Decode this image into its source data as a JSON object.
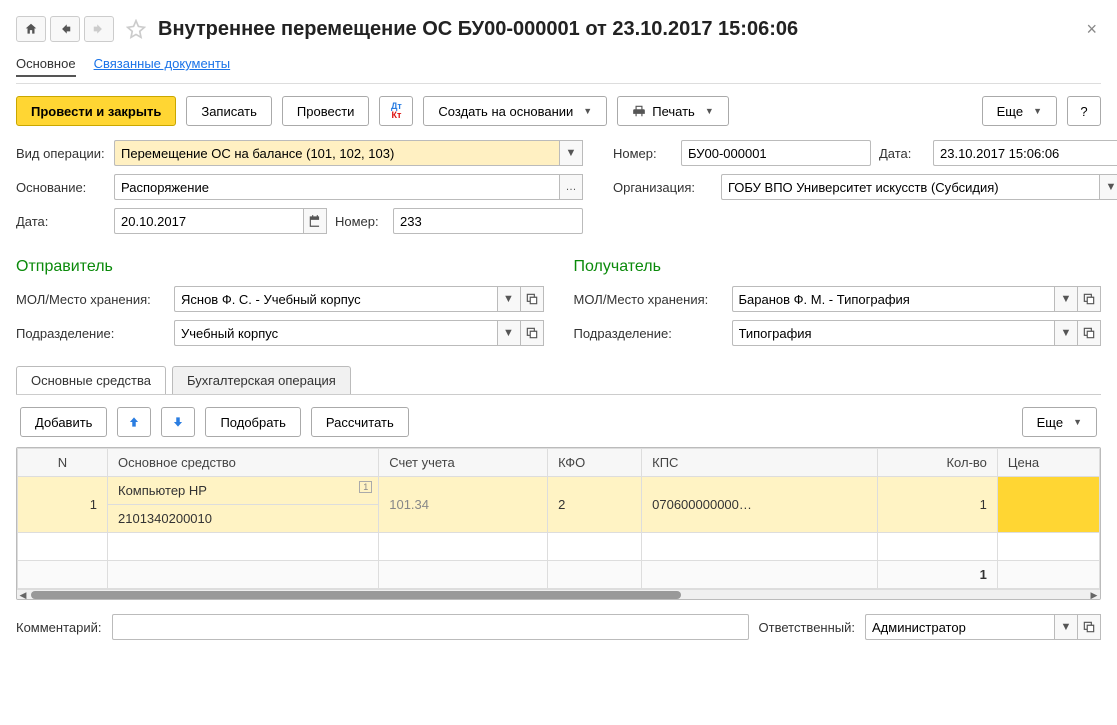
{
  "header": {
    "title": "Внутреннее перемещение ОС БУ00-000001 от 23.10.2017 15:06:06"
  },
  "nav_tabs": {
    "main": "Основное",
    "linked": "Связанные документы"
  },
  "toolbar": {
    "post_close": "Провести и закрыть",
    "save": "Записать",
    "post": "Провести",
    "create_based": "Создать на основании",
    "print": "Печать",
    "more": "Еще",
    "help": "?"
  },
  "fields": {
    "operation_type_label": "Вид операции:",
    "operation_type_value": "Перемещение ОС на балансе (101, 102, 103)",
    "number_label": "Номер:",
    "number_value": "БУ00-000001",
    "date_label": "Дата:",
    "date_value": "23.10.2017 15:06:06",
    "basis_label": "Основание:",
    "basis_value": "Распоряжение",
    "org_label": "Организация:",
    "org_value": "ГОБУ ВПО Университет искусств (Субсидия)",
    "basis_date_label": "Дата:",
    "basis_date_value": "20.10.2017",
    "basis_number_label": "Номер:",
    "basis_number_value": "233"
  },
  "sender": {
    "title": "Отправитель",
    "mol_label": "МОЛ/Место хранения:",
    "mol_value": "Яснов Ф. С. - Учебный корпус",
    "dept_label": "Подразделение:",
    "dept_value": "Учебный корпус"
  },
  "receiver": {
    "title": "Получатель",
    "mol_label": "МОЛ/Место хранения:",
    "mol_value": "Баранов Ф. М. - Типография",
    "dept_label": "Подразделение:",
    "dept_value": "Типография"
  },
  "subtabs": {
    "assets": "Основные средства",
    "accounting": "Бухгалтерская операция"
  },
  "table_toolbar": {
    "add": "Добавить",
    "select": "Подобрать",
    "calculate": "Рассчитать",
    "more": "Еще"
  },
  "table": {
    "headers": {
      "n": "N",
      "asset": "Основное средство",
      "account": "Счет учета",
      "kfo": "КФО",
      "kps": "КПС",
      "qty": "Кол-во",
      "price": "Цена"
    },
    "row": {
      "n": "1",
      "asset_line1": "Компьютер HP",
      "asset_line2": "2101340200010",
      "account": "101.34",
      "kfo": "2",
      "kps": "070600000000…",
      "qty": "1"
    },
    "footer": {
      "qty": "1"
    }
  },
  "footer": {
    "comment_label": "Комментарий:",
    "responsible_label": "Ответственный:",
    "responsible_value": "Администратор"
  }
}
